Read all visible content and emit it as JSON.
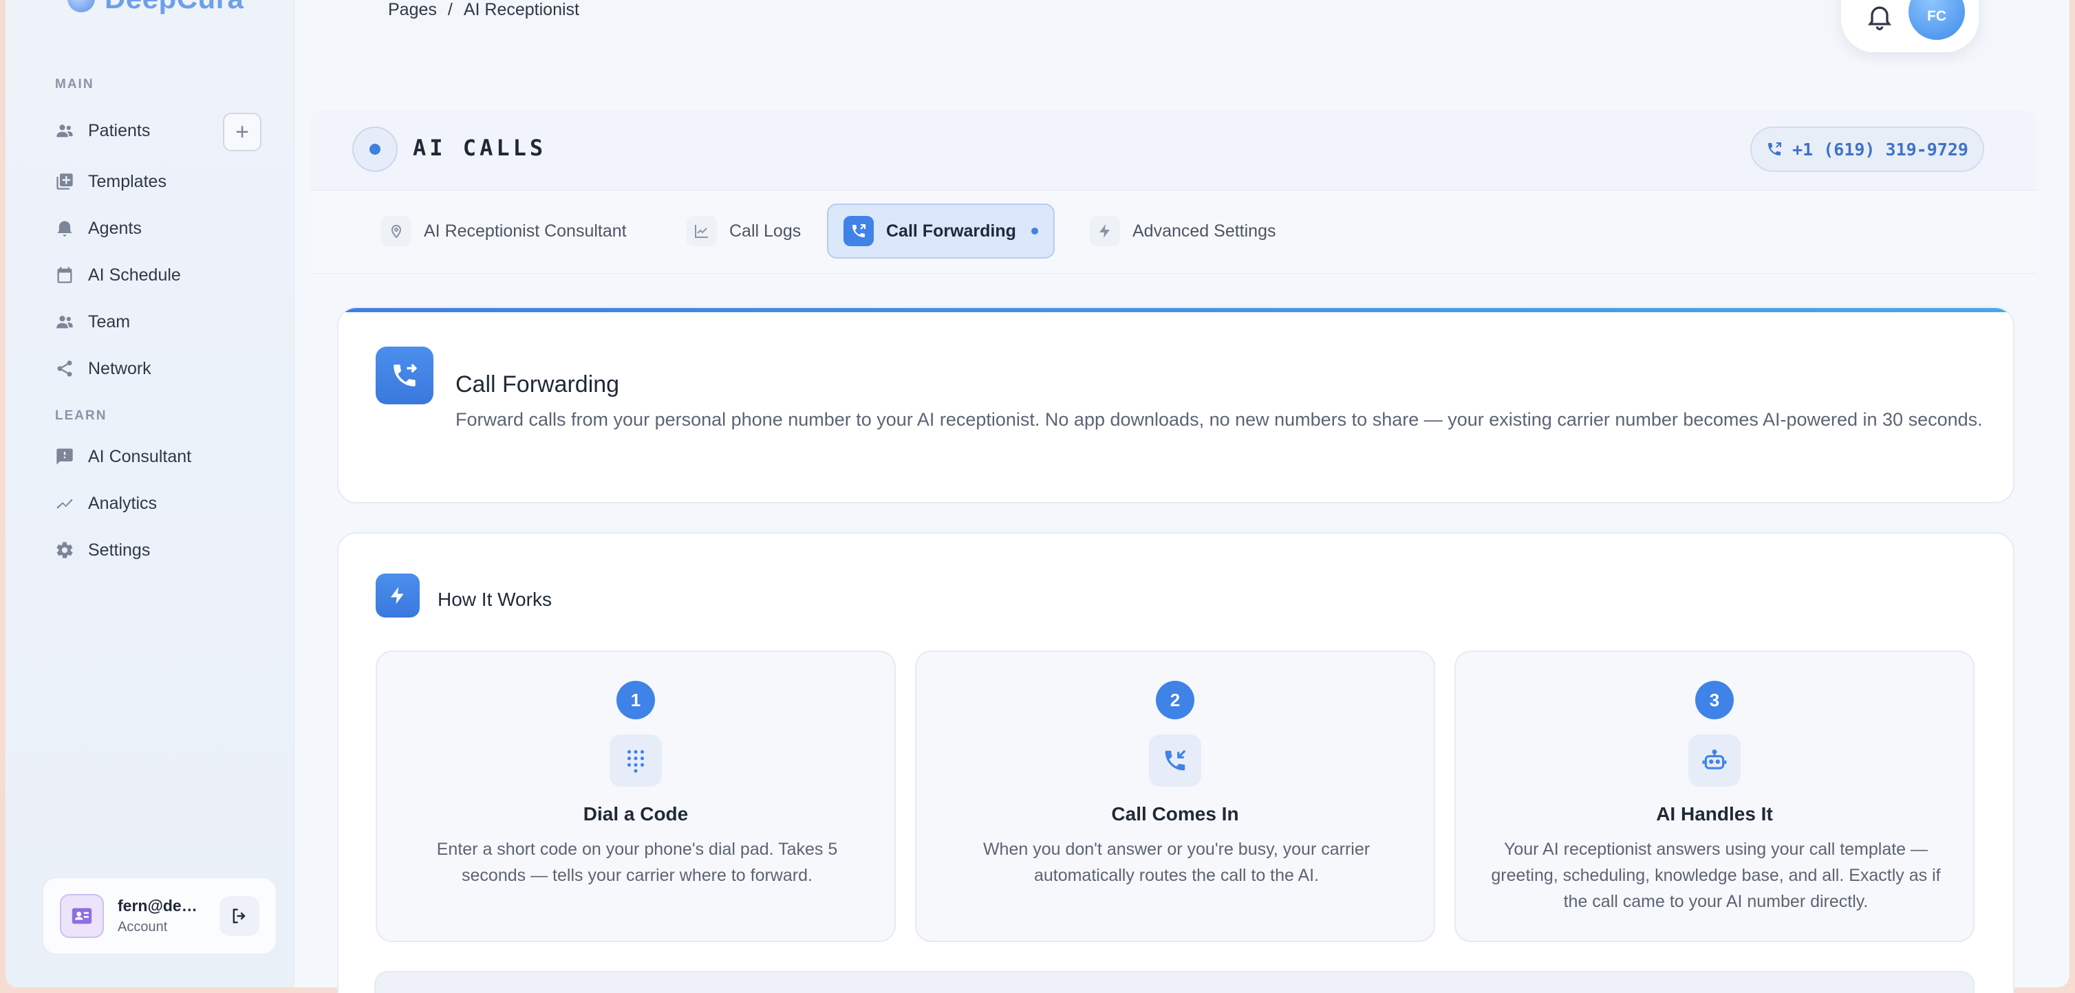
{
  "app": {
    "logo_text": "DeepCura"
  },
  "sidebar": {
    "main_label": "MAIN",
    "learn_label": "LEARN",
    "items": [
      {
        "label": "Patients",
        "icon": "people-icon"
      },
      {
        "label": "Templates",
        "icon": "templates-icon"
      },
      {
        "label": "Agents",
        "icon": "bell-agent-icon"
      },
      {
        "label": "AI Schedule",
        "icon": "calendar-icon"
      },
      {
        "label": "Team",
        "icon": "team-icon"
      },
      {
        "label": "Network",
        "icon": "share-icon"
      }
    ],
    "learn_items": [
      {
        "label": "AI Consultant",
        "icon": "chat-alert-icon"
      },
      {
        "label": "Analytics",
        "icon": "trend-icon"
      },
      {
        "label": "Settings",
        "icon": "gear-icon"
      }
    ],
    "add_label": "+"
  },
  "account": {
    "email": "fern@deepcura.com",
    "role": "Account"
  },
  "header": {
    "breadcrumb_root": "Pages",
    "breadcrumb_sep": "/",
    "breadcrumb_current": "AI Receptionist",
    "avatar_initials": "FC"
  },
  "calls": {
    "title": "AI CALLS",
    "phone": "+1 (619) 319-9729"
  },
  "tabs": [
    {
      "label": "AI Receptionist Consultant",
      "icon": "location-icon",
      "active": false
    },
    {
      "label": "Call Logs",
      "icon": "chart-icon",
      "active": false
    },
    {
      "label": "Call Forwarding",
      "icon": "phone-forward-icon",
      "active": true
    },
    {
      "label": "Advanced Settings",
      "icon": "bolt-icon",
      "active": false
    }
  ],
  "forwarding": {
    "title": "Call Forwarding",
    "description": "Forward calls from your personal phone number to your AI receptionist. No app downloads, no new numbers to share — your existing carrier number becomes AI-powered in 30 seconds."
  },
  "how_it_works": {
    "title": "How It Works",
    "steps": [
      {
        "num": "1",
        "title": "Dial a Code",
        "desc": "Enter a short code on your phone's dial pad. Takes 5 seconds — tells your carrier where to forward.",
        "icon": "dialpad-icon"
      },
      {
        "num": "2",
        "title": "Call Comes In",
        "desc": "When you don't answer or you're busy, your carrier automatically routes the call to the AI.",
        "icon": "phone-incoming-icon"
      },
      {
        "num": "3",
        "title": "AI Handles It",
        "desc": "Your AI receptionist answers using your call template — greeting, scheduling, knowledge base, and all. Exactly as if the call came to your AI number directly.",
        "icon": "robot-icon"
      }
    ]
  },
  "colors": {
    "accent": "#3f82e8",
    "accent_light": "#dbe8fb",
    "text": "#1f2937",
    "muted": "#5b6474"
  }
}
